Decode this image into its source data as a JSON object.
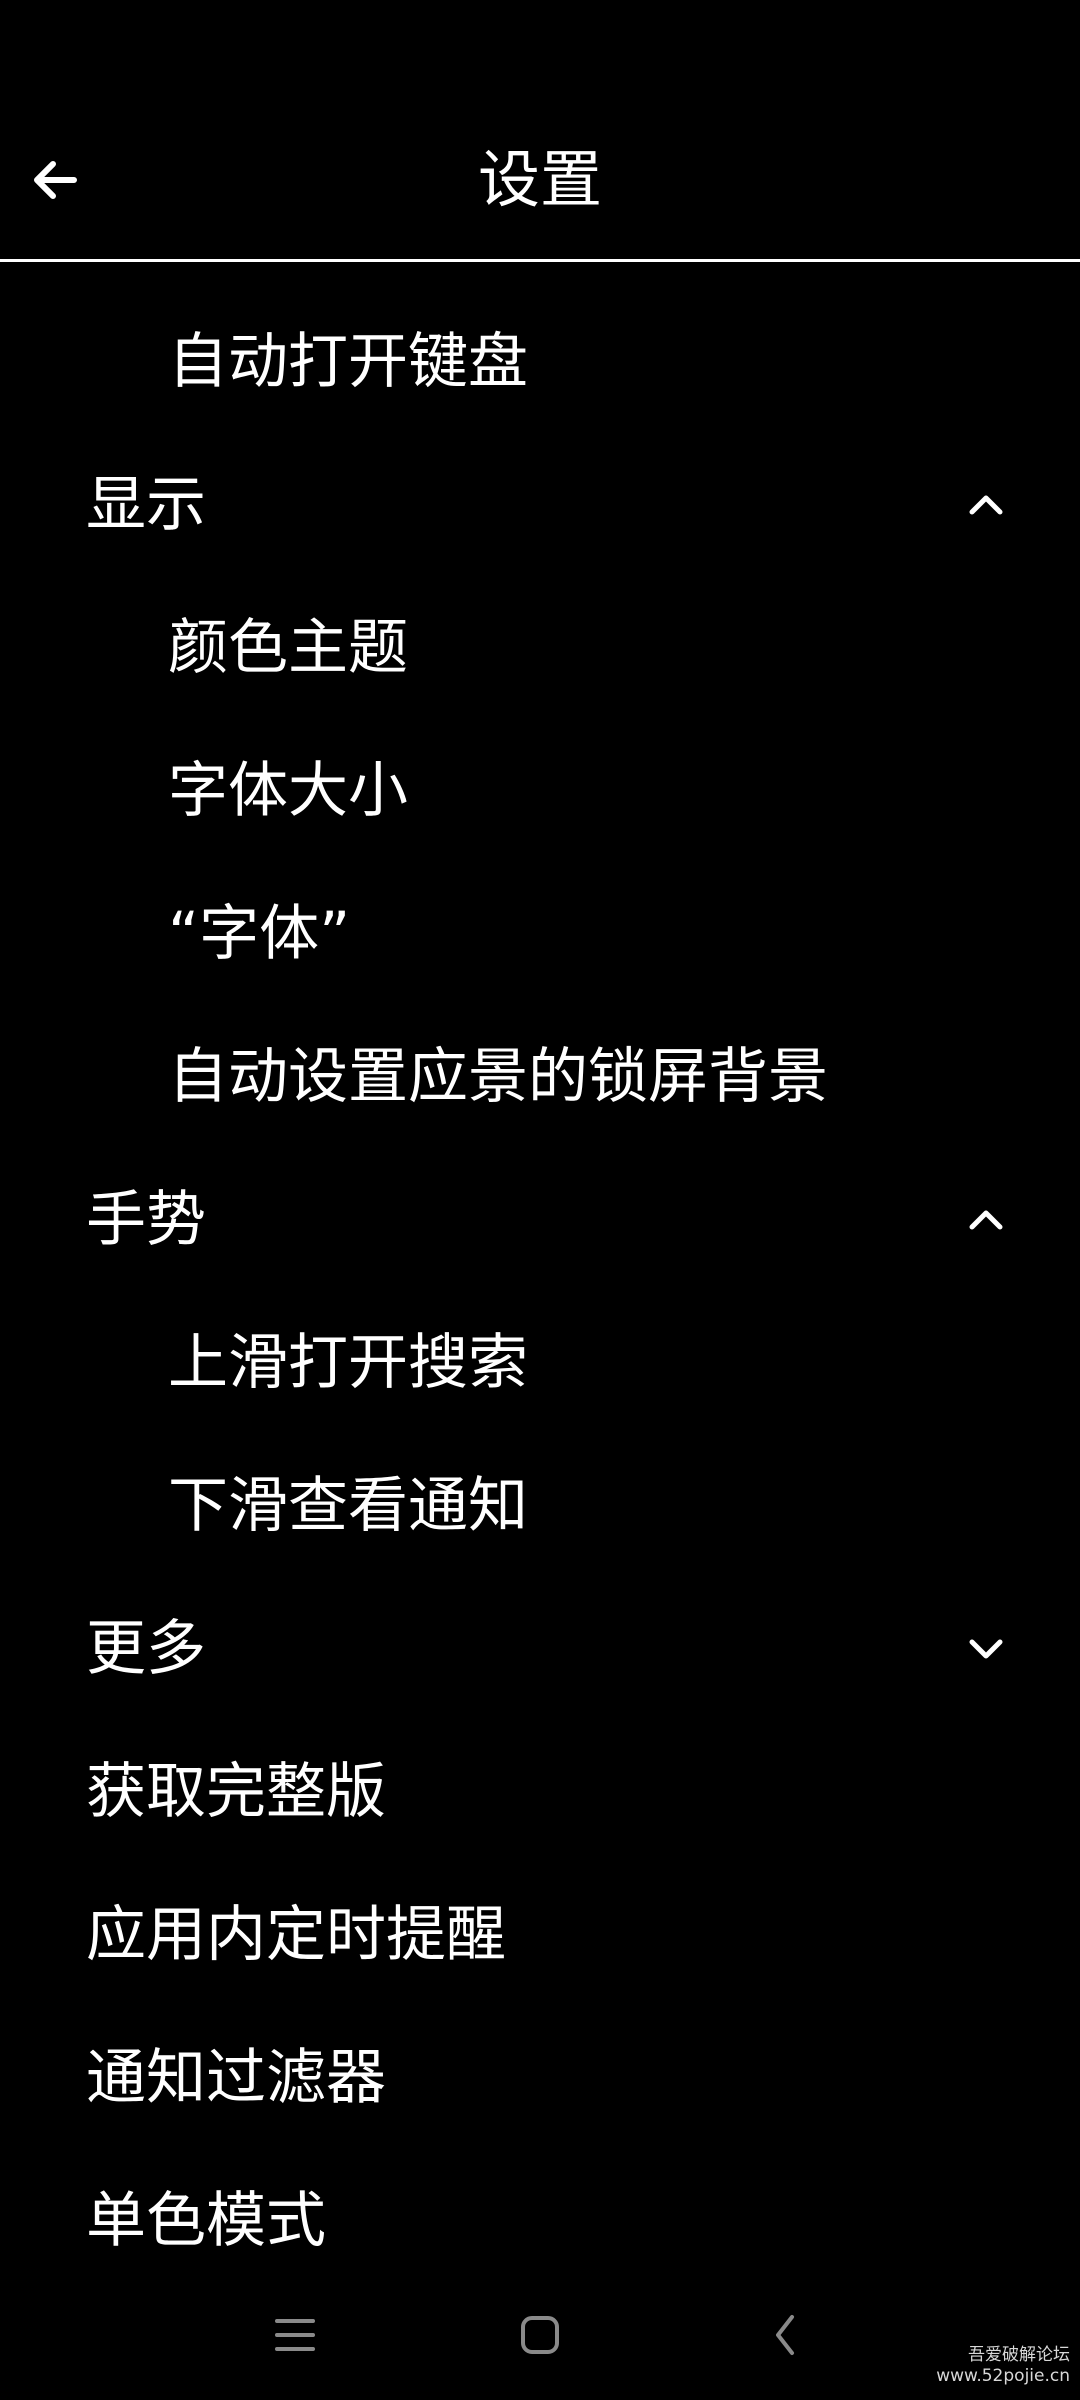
{
  "header": {
    "title": "设置",
    "back_icon": "arrow-left-icon"
  },
  "items": [
    {
      "label": "自动打开键盘",
      "level": "sub"
    },
    {
      "label": "显示",
      "level": "section",
      "chevron": "chevron-up-icon"
    },
    {
      "label": "颜色主题",
      "level": "sub"
    },
    {
      "label": "字体大小",
      "level": "sub"
    },
    {
      "label": "“字体”",
      "level": "sub"
    },
    {
      "label": "自动设置应景的锁屏背景",
      "level": "sub"
    },
    {
      "label": "手势",
      "level": "section",
      "chevron": "chevron-up-icon"
    },
    {
      "label": "上滑打开搜索",
      "level": "sub"
    },
    {
      "label": "下滑查看通知",
      "level": "sub"
    },
    {
      "label": "更多",
      "level": "section",
      "chevron": "chevron-down-icon"
    },
    {
      "label": "获取完整版",
      "level": "section"
    },
    {
      "label": "应用内定时提醒",
      "level": "section"
    },
    {
      "label": "通知过滤器",
      "level": "section"
    },
    {
      "label": "单色模式",
      "level": "section"
    }
  ],
  "navbar": {
    "menu_icon": "menu-icon",
    "home_icon": "home-icon",
    "back_icon": "back-chevron-icon"
  },
  "watermark": {
    "line1": "吾爱破解论坛",
    "line2": "www.52pojie.cn"
  },
  "colors": {
    "background": "#000000",
    "foreground": "#ffffff",
    "nav_icons": "#8a8a8a"
  }
}
